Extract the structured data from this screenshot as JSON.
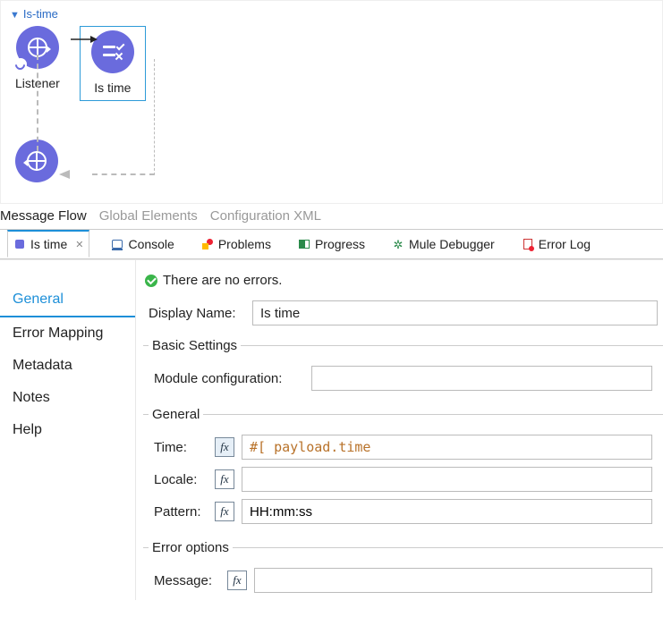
{
  "flow": {
    "name": "Is-time"
  },
  "nodes": {
    "listener": {
      "label": "Listener"
    },
    "is_time": {
      "label": "Is time"
    }
  },
  "editor_tabs": [
    "Message Flow",
    "Global Elements",
    "Configuration XML"
  ],
  "view_tabs": {
    "is_time": "Is time",
    "console": "Console",
    "problems": "Problems",
    "progress": "Progress",
    "debugger": "Mule Debugger",
    "error_log": "Error Log"
  },
  "sidebar": {
    "general": "General",
    "error_mapping": "Error Mapping",
    "metadata": "Metadata",
    "notes": "Notes",
    "help": "Help"
  },
  "status": {
    "text": "There are no errors."
  },
  "display_name": {
    "label": "Display Name:",
    "value": "Is time"
  },
  "basic_settings": {
    "legend": "Basic Settings",
    "module_config_label": "Module configuration:",
    "module_config_value": ""
  },
  "general": {
    "legend": "General",
    "time_label": "Time:",
    "time_value": "#[ payload.time",
    "locale_label": "Locale:",
    "locale_value": "",
    "pattern_label": "Pattern:",
    "pattern_value": "HH:mm:ss"
  },
  "error_options": {
    "legend": "Error options",
    "message_label": "Message:",
    "message_value": ""
  }
}
